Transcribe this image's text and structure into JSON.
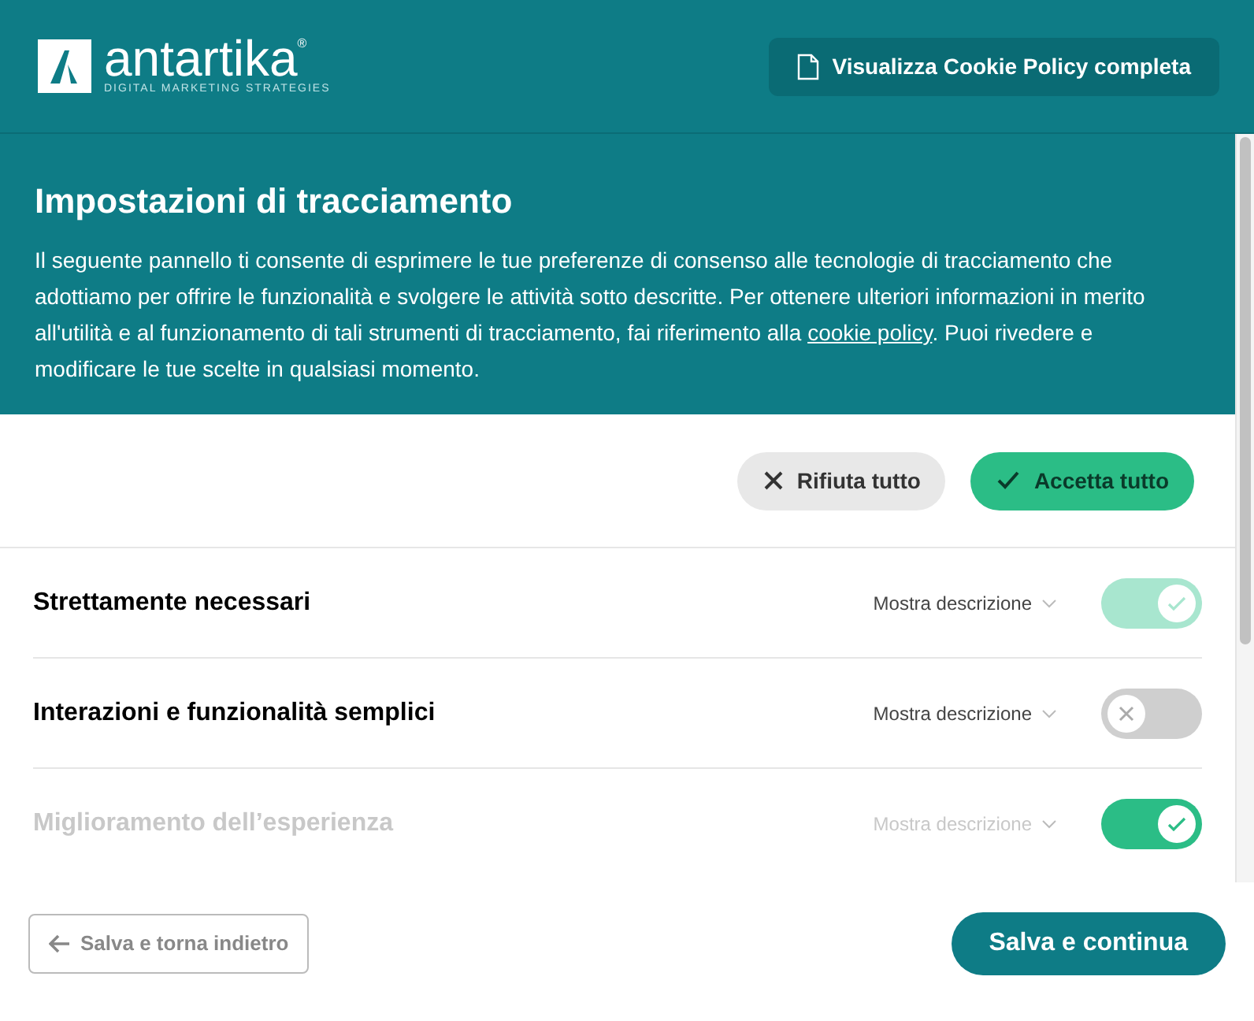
{
  "header": {
    "logo": {
      "name": "antartika",
      "registered": "®",
      "tagline": "DIGITAL MARKETING STRATEGIES"
    },
    "policy_button": "Visualizza Cookie Policy completa"
  },
  "intro": {
    "title": "Impostazioni di tracciamento",
    "text_before": "Il seguente pannello ti consente di esprimere le tue preferenze di consenso alle tecnologie di tracciamento che adottiamo per offrire le funzionalità e svolgere le attività sotto descritte. Per ottenere ulteriori informazioni in merito all'utilità e al funzionamento di tali strumenti di tracciamento, fai riferimento alla ",
    "link": "cookie policy",
    "text_after": ". Puoi rivedere e modificare le tue scelte in qualsiasi momento."
  },
  "actions": {
    "reject": "Rifiuta tutto",
    "accept": "Accetta tutto"
  },
  "categories": [
    {
      "name": "Strettamente necessari",
      "toggle_label": "Mostra descrizione",
      "on": true,
      "disabled": true,
      "faded": false
    },
    {
      "name": "Interazioni e funzionalità semplici",
      "toggle_label": "Mostra descrizione",
      "on": false,
      "disabled": false,
      "faded": false
    },
    {
      "name": "Miglioramento dell’esperienza",
      "toggle_label": "Mostra descrizione",
      "on": true,
      "disabled": false,
      "faded": true
    }
  ],
  "footer": {
    "back": "Salva e torna indietro",
    "continue": "Salva e continua"
  }
}
